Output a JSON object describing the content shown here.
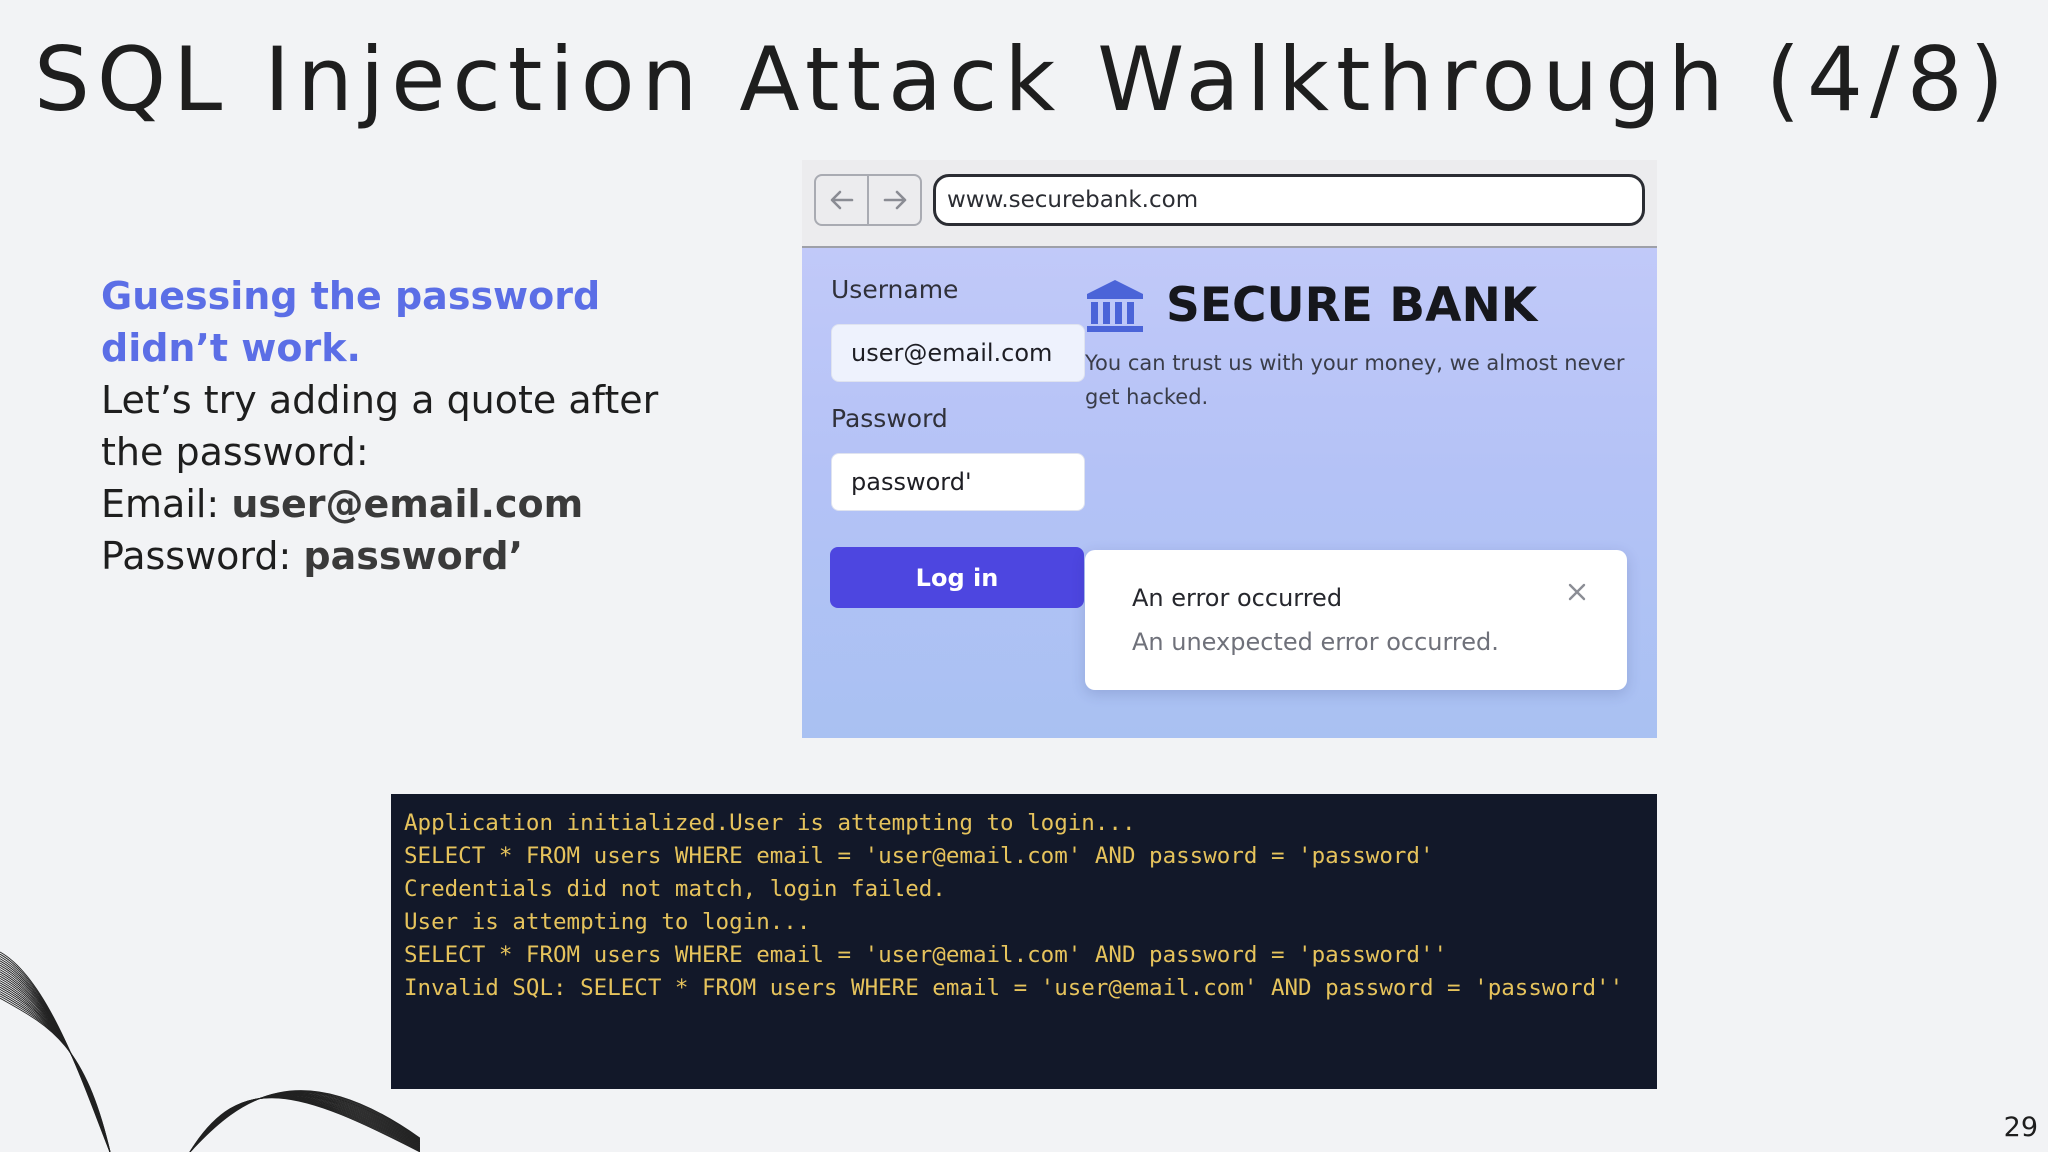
{
  "slide": {
    "title": "SQL Injection Attack Walkthrough (4/8)",
    "page_number": "29"
  },
  "explanation": {
    "highlight_line1": "Guessing the password",
    "highlight_line2": "didn’t work.",
    "line3": "Let’s try adding a quote after",
    "line4": "the password:",
    "email_label": "Email: ",
    "email_value": "user@email.com",
    "password_label": "Password: ",
    "password_value": "password’"
  },
  "browser": {
    "back_icon": "arrow-left-icon",
    "forward_icon": "arrow-right-icon",
    "url": "www.securebank.com",
    "login_form": {
      "username_label": "Username",
      "username_value": "user@email.com",
      "password_label": "Password",
      "password_value": "password'",
      "login_button": "Log in"
    },
    "bank": {
      "logo_icon": "bank-building-icon",
      "name": "SECURE BANK",
      "tagline": "You can trust us with your money, we almost never get hacked."
    },
    "error_toast": {
      "title": "An error occurred",
      "message": "An unexpected error occurred.",
      "close_icon": "close-icon"
    }
  },
  "terminal": {
    "lines": [
      "Application initialized.User is attempting to login...",
      "SELECT * FROM users WHERE email = 'user@email.com' AND password = 'password'",
      "Credentials did not match, login failed.",
      "User is attempting to login...",
      "SELECT * FROM users WHERE email = 'user@email.com' AND password = 'password''",
      "Invalid SQL: SELECT * FROM users WHERE email = 'user@email.com' AND password = 'password''"
    ]
  },
  "colors": {
    "background": "#f2f3f5",
    "accent_text": "#5b6ee6",
    "login_button": "#4d46e0",
    "terminal_bg": "#121829",
    "terminal_text": "#e6c35c"
  }
}
